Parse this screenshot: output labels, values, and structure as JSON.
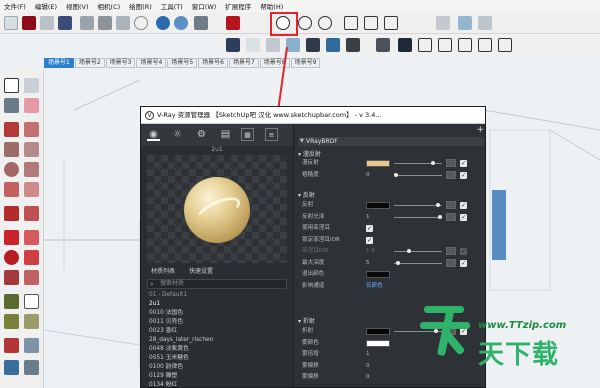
{
  "menu": [
    "文件(F)",
    "编辑(E)",
    "视图(V)",
    "相机(C)",
    "绘图(R)",
    "工具(T)",
    "窗口(W)",
    "扩展程序",
    "帮助(H)"
  ],
  "scene_tabs": [
    "场景号1",
    "场景号2",
    "场景号3",
    "场景号4",
    "场景号5",
    "场景号6",
    "场景号7",
    "场景号8",
    "场景号9"
  ],
  "active_scene_index": 0,
  "vray": {
    "title": "V-Ray 资源管理器 【SketchUp吧 汉化 www.sketchupbar.com】 - v 3.4...",
    "preview_label": "2u1",
    "subtabs": [
      "材质列表",
      "快速设置"
    ],
    "search_placeholder": "搜索材质",
    "materials": [
      {
        "label": "01 - Default1",
        "state": "hdr"
      },
      {
        "label": "2u1",
        "state": "sel"
      },
      {
        "label": "0010 法国色",
        "state": ""
      },
      {
        "label": "0011 贝壳色",
        "state": ""
      },
      {
        "label": "0023 香红",
        "state": ""
      },
      {
        "label": "28_days_later_rischen",
        "state": ""
      },
      {
        "label": "0048 淡紫黄色",
        "state": ""
      },
      {
        "label": "0051 玉米糖色",
        "state": ""
      },
      {
        "label": "0100 韵律色",
        "state": ""
      },
      {
        "label": "0129 雕塑",
        "state": ""
      },
      {
        "label": "0134 粉红",
        "state": ""
      }
    ],
    "add_label": "+",
    "brdf_label": "VRayBRDF",
    "sections": {
      "diffuse": "漫反射",
      "reflection": "反射",
      "refraction": "折射"
    },
    "diffuse_rows": [
      {
        "label": "漫反射",
        "kind": "swatch",
        "color": "#e6c78f",
        "slider": 0.85
      },
      {
        "label": "粗糙度",
        "kind": "number",
        "value": "0",
        "slider": 0.0
      }
    ],
    "reflection_rows": [
      {
        "label": "反射",
        "kind": "swatch",
        "color": "#080808",
        "slider": 0.95
      },
      {
        "label": "反射光泽",
        "kind": "number",
        "value": "1",
        "slider": 1.0
      },
      {
        "label": "使用菲涅耳",
        "kind": "check"
      },
      {
        "label": "锁定菲涅耳IOR",
        "kind": "check"
      },
      {
        "label": "菲涅耳IOR",
        "kind": "number_dim",
        "value": "1.6",
        "slider": 0.3
      },
      {
        "label": "最大深度",
        "kind": "number",
        "value": "5",
        "slider": 0.05
      },
      {
        "label": "退出颜色",
        "kind": "swatch",
        "color": "#0a0a0a"
      },
      {
        "label": "影响通道",
        "kind": "link",
        "value": "仅颜色"
      }
    ],
    "refraction_rows": [
      {
        "label": "折射",
        "kind": "swatch",
        "color": "#050505",
        "slider": 0.9
      },
      {
        "label": "雾颜色",
        "kind": "swatch",
        "color": "#ffffff"
      },
      {
        "label": "雾倍增",
        "kind": "number",
        "value": "1"
      },
      {
        "label": "雾偏移",
        "kind": "number",
        "value": "0"
      },
      {
        "label": "雾偏移",
        "kind": "number",
        "value": "0"
      }
    ]
  },
  "watermark": {
    "url": "www.TTzip.com",
    "text": "天下载"
  }
}
